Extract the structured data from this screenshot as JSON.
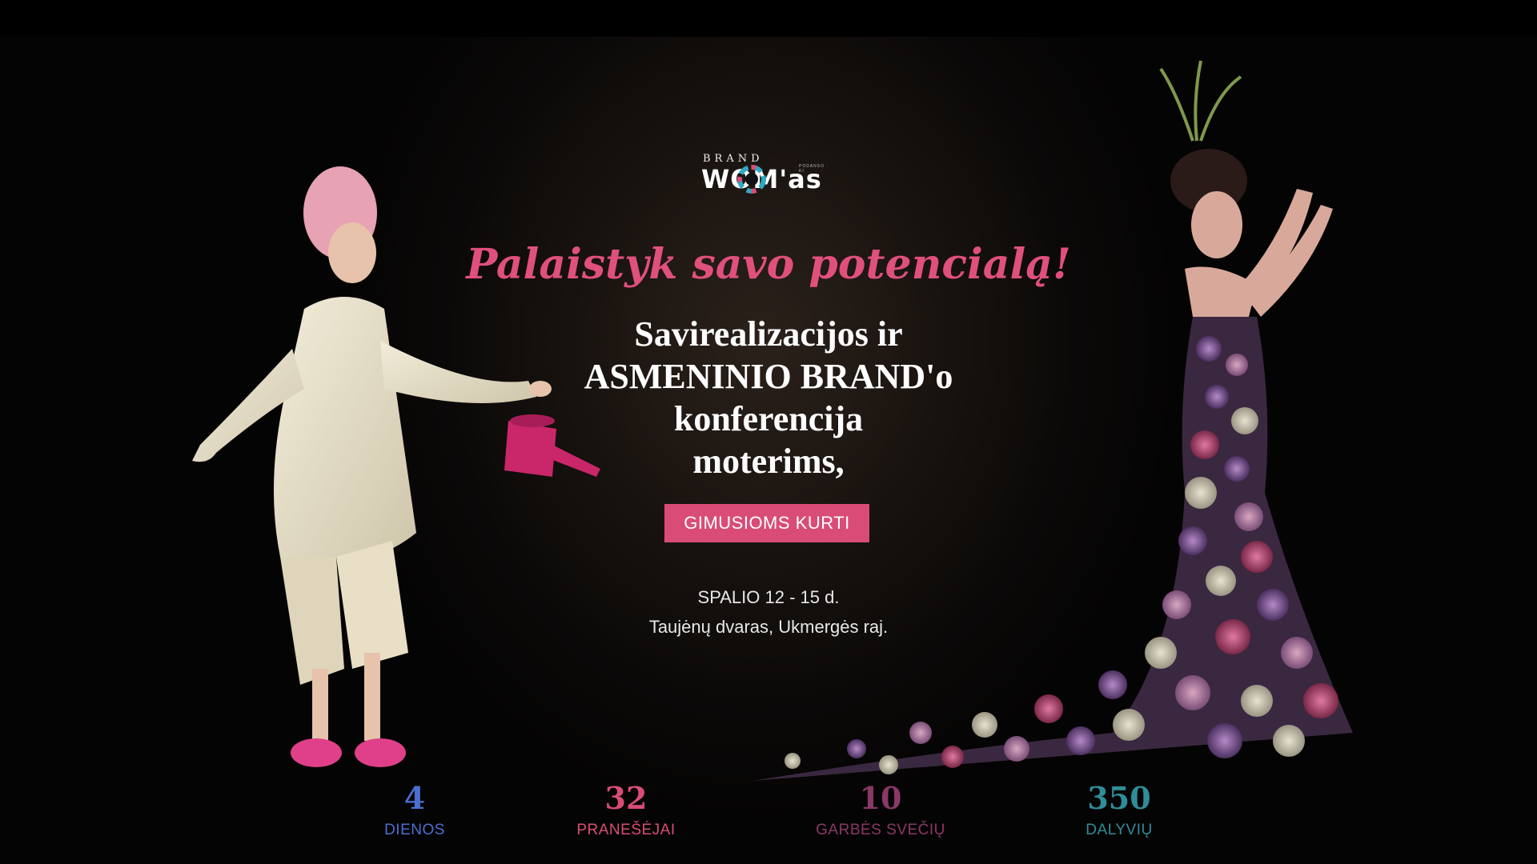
{
  "logo": {
    "brand_text": "BRAND",
    "word_text": "WOM'as",
    "small_text": "PODANSO · KI"
  },
  "hero": {
    "tagline": "Palaistyk savo potencialą!",
    "headline_lines": [
      "Savirealizacijos ir",
      "ASMENINIO BRAND'o",
      "konferencija",
      "moterims,"
    ],
    "cta_label": "GIMUSIOMS KURTI",
    "date_text": "SPALIO 12 - 15 d.",
    "location_text": "Taujėnų dvaras, Ukmergės raj."
  },
  "stats": [
    {
      "number": "4",
      "label": "DIENOS",
      "color": "#4a6fd0"
    },
    {
      "number": "32",
      "label": "PRANEŠĖJAI",
      "color": "#d94c76"
    },
    {
      "number": "10",
      "label": "GARBĖS SVEČIŲ",
      "color": "#8a3868"
    },
    {
      "number": "350",
      "label": "DALYVIŲ",
      "color": "#2f8d9a"
    }
  ],
  "colors": {
    "accent": "#d94c76",
    "background": "#000000"
  }
}
